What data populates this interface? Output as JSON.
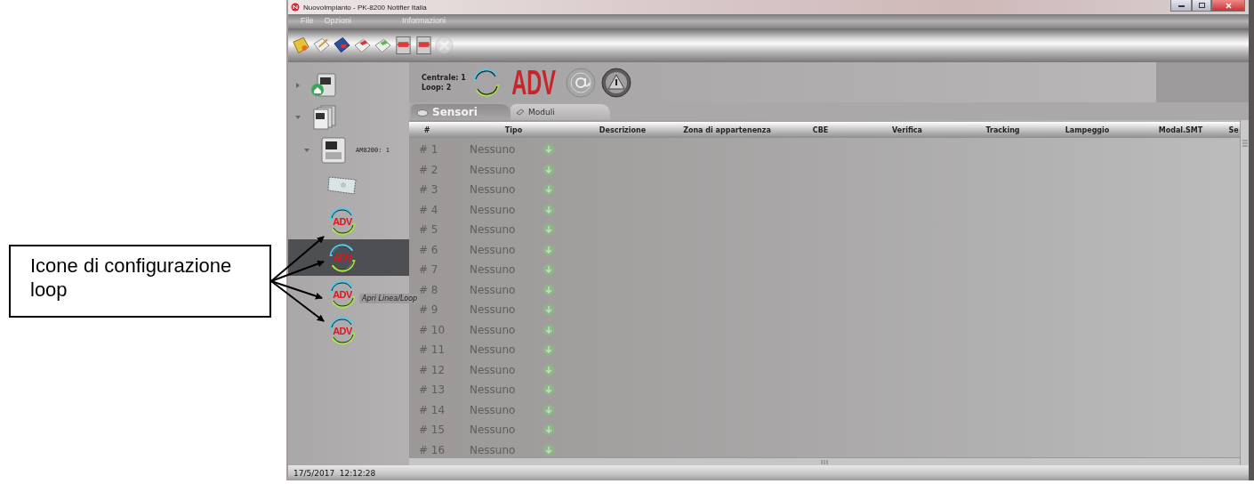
{
  "annotation": {
    "text": "Icone di configurazione loop"
  },
  "window": {
    "title": "NuovoImpianto - PK-8200 Notifier Italia"
  },
  "menu": [
    "File",
    "Opzioni",
    "Informazioni"
  ],
  "toolbar": [
    {
      "kind": "folder",
      "disabled": false
    },
    {
      "kind": "edit",
      "disabled": false
    },
    {
      "kind": "save",
      "disabled": false
    },
    {
      "kind": "export-red",
      "disabled": false
    },
    {
      "kind": "export-green",
      "disabled": false
    },
    {
      "kind": "upload",
      "disabled": false
    },
    {
      "kind": "download",
      "disabled": false
    },
    {
      "kind": "tools",
      "disabled": true
    }
  ],
  "tree": [
    {
      "kind": "panel-home",
      "expanded": false,
      "selected": false
    },
    {
      "kind": "rack",
      "expanded": true,
      "selected": false,
      "children": [
        {
          "kind": "panel",
          "label": "AM8200: 1",
          "expanded": true,
          "selected": false,
          "children": [
            {
              "kind": "card",
              "selected": false
            },
            {
              "kind": "loop",
              "badge": "ADV",
              "selected": false
            },
            {
              "kind": "loop",
              "badge": "ADV",
              "selected": true
            },
            {
              "kind": "loop",
              "badge": "ADV",
              "selected": false,
              "tooltip": "Apri Linea/Loop"
            },
            {
              "kind": "loop",
              "badge": "ADV",
              "selected": false
            }
          ]
        }
      ]
    }
  ],
  "header": {
    "centrale": "Centrale: 1",
    "loop": "Loop: 2",
    "badge": "ADV"
  },
  "tabs": [
    {
      "label": "Sensori",
      "selected": true
    },
    {
      "label": "Moduli",
      "selected": false
    }
  ],
  "table": {
    "columns": [
      "#",
      "Tipo",
      "Descrizione",
      "Zona di appartenenza",
      "CBE",
      "Verifica",
      "Tracking",
      "Lampeggio",
      "Modal.SMT",
      "Se"
    ],
    "rows": [
      {
        "number": "# 1",
        "tipo": "Nessuno"
      },
      {
        "number": "# 2",
        "tipo": "Nessuno"
      },
      {
        "number": "# 3",
        "tipo": "Nessuno"
      },
      {
        "number": "# 4",
        "tipo": "Nessuno"
      },
      {
        "number": "# 5",
        "tipo": "Nessuno"
      },
      {
        "number": "# 6",
        "tipo": "Nessuno"
      },
      {
        "number": "# 7",
        "tipo": "Nessuno"
      },
      {
        "number": "# 8",
        "tipo": "Nessuno"
      },
      {
        "number": "# 9",
        "tipo": "Nessuno"
      },
      {
        "number": "# 10",
        "tipo": "Nessuno"
      },
      {
        "number": "# 11",
        "tipo": "Nessuno"
      },
      {
        "number": "# 12",
        "tipo": "Nessuno"
      },
      {
        "number": "# 13",
        "tipo": "Nessuno"
      },
      {
        "number": "# 14",
        "tipo": "Nessuno"
      },
      {
        "number": "# 15",
        "tipo": "Nessuno"
      },
      {
        "number": "# 16",
        "tipo": "Nessuno"
      }
    ]
  },
  "status_bar": "17/5/2017  12:12:28"
}
